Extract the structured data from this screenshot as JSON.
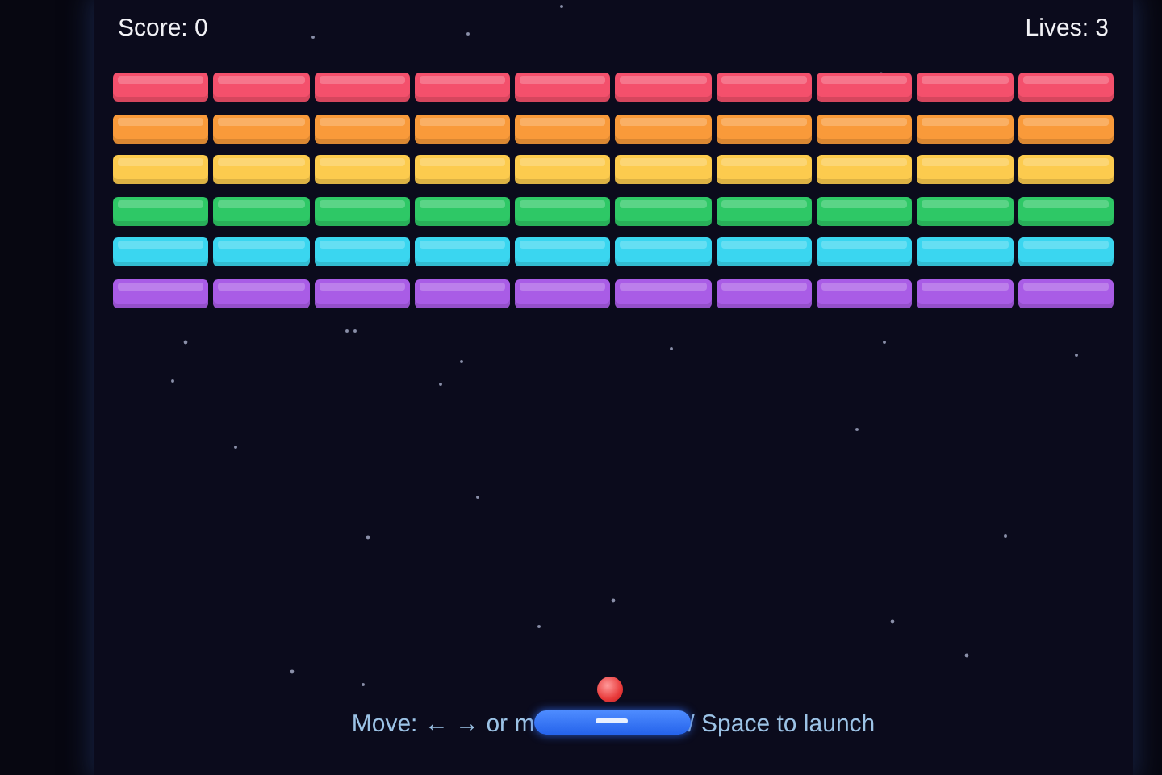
{
  "hud": {
    "score": "Score: 0",
    "lives": "Lives: 3"
  },
  "brick_rows": [
    {
      "color": "#f4506c"
    },
    {
      "color": "#f99a3a"
    },
    {
      "color": "#fccb4e"
    },
    {
      "color": "#2ec866"
    },
    {
      "color": "#3ad6f0"
    },
    {
      "color": "#a95ce6"
    }
  ],
  "hint": {
    "before_paddle": "Move: ← → or m",
    "after_paddle": "/ Space to launch"
  }
}
